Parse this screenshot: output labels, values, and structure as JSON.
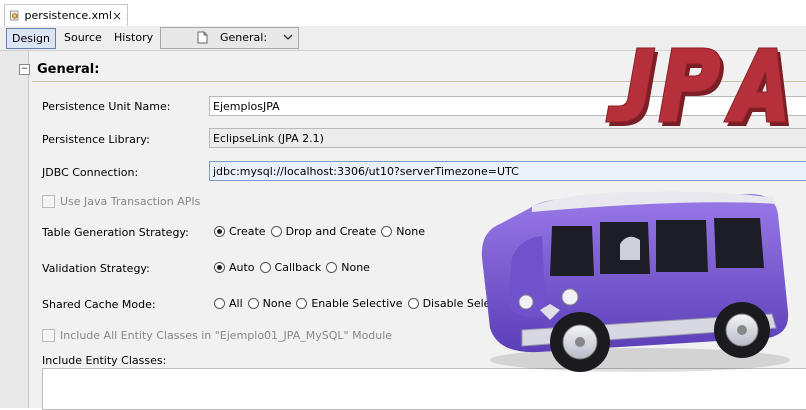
{
  "file_tab": {
    "title": "persistence.xml",
    "close": "×"
  },
  "view_tabs": [
    {
      "label": "Design",
      "active": true
    },
    {
      "label": "Source",
      "active": false
    },
    {
      "label": "History",
      "active": false
    }
  ],
  "section_dropdown": {
    "value": "General:"
  },
  "section": {
    "title": "General:",
    "collapse_symbol": "−"
  },
  "form": {
    "persistence_unit_name": {
      "label": "Persistence Unit Name:",
      "value": "EjemplosJPA"
    },
    "persistence_library": {
      "label": "Persistence Library:",
      "value": "EclipseLink (JPA 2.1)"
    },
    "jdbc_connection": {
      "label": "JDBC Connection:",
      "value": "jdbc:mysql://localhost:3306/ut10?serverTimezone=UTC"
    },
    "use_jta": {
      "label": "Use Java Transaction APIs",
      "checked": false,
      "enabled": false
    },
    "table_generation": {
      "label": "Table Generation Strategy:",
      "options": [
        "Create",
        "Drop and Create",
        "None"
      ],
      "selected": "Create"
    },
    "validation": {
      "label": "Validation Strategy:",
      "options": [
        "Auto",
        "Callback",
        "None"
      ],
      "selected": "Auto"
    },
    "shared_cache": {
      "label": "Shared Cache Mode:",
      "options": [
        "All",
        "None",
        "Enable Selective",
        "Disable Selective"
      ],
      "selected": null
    },
    "include_all": {
      "label": "Include All Entity Classes in \"Ejemplo01_JPA_MySQL\" Module",
      "checked": false,
      "enabled": false
    },
    "include_entity_classes": {
      "label": "Include Entity Classes:"
    }
  },
  "overlay": {
    "logo_text": "JPA",
    "logo_color": "#b5303a",
    "van_color": "#7b5cd6"
  },
  "colors": {
    "active_tab_bg": "#dbe4f3",
    "active_tab_border": "#6a7fa8",
    "section_rule": "#cfc0a0"
  }
}
